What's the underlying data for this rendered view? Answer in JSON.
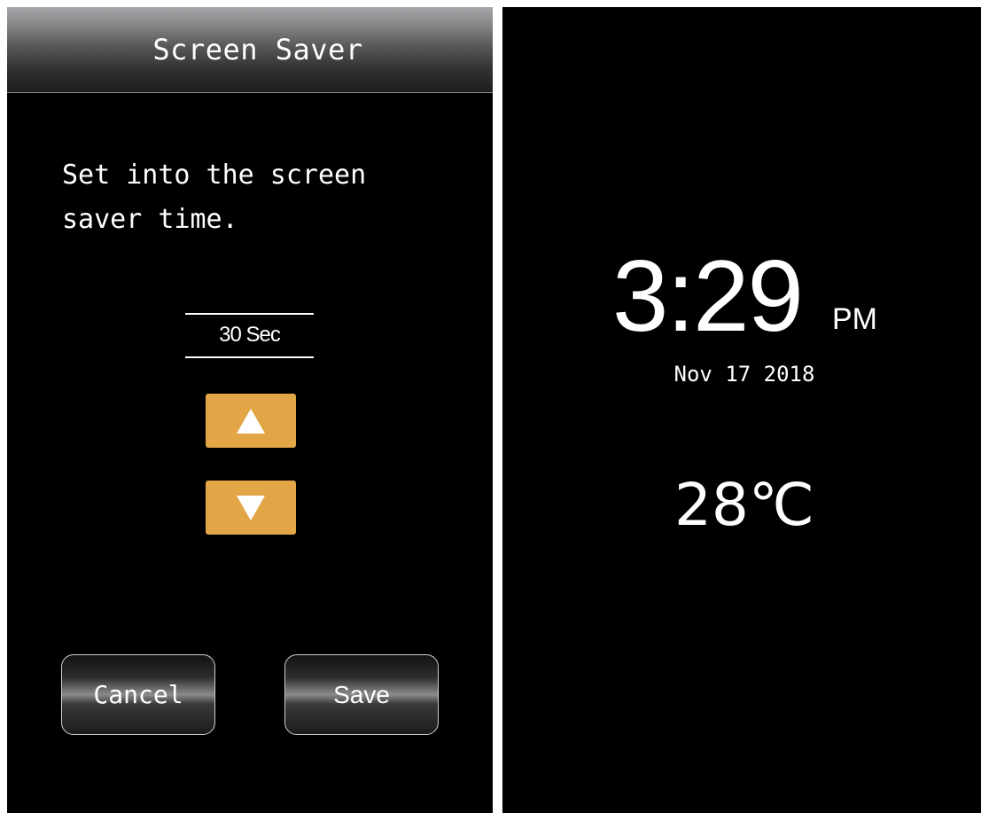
{
  "settings_screen": {
    "title": "Screen Saver",
    "instruction": "Set into the screen\nsaver time.",
    "current_value": "30 Sec",
    "up_icon": "triangle-up-icon",
    "down_icon": "triangle-down-icon",
    "cancel_label": "Cancel",
    "save_label": "Save",
    "colors": {
      "background": "#000000",
      "stepper_button": "#e2a646",
      "text": "#ffffff"
    }
  },
  "screensaver_screen": {
    "time": "3:29",
    "ampm": "PM",
    "date": "Nov 17 2018",
    "temperature": "28℃"
  }
}
